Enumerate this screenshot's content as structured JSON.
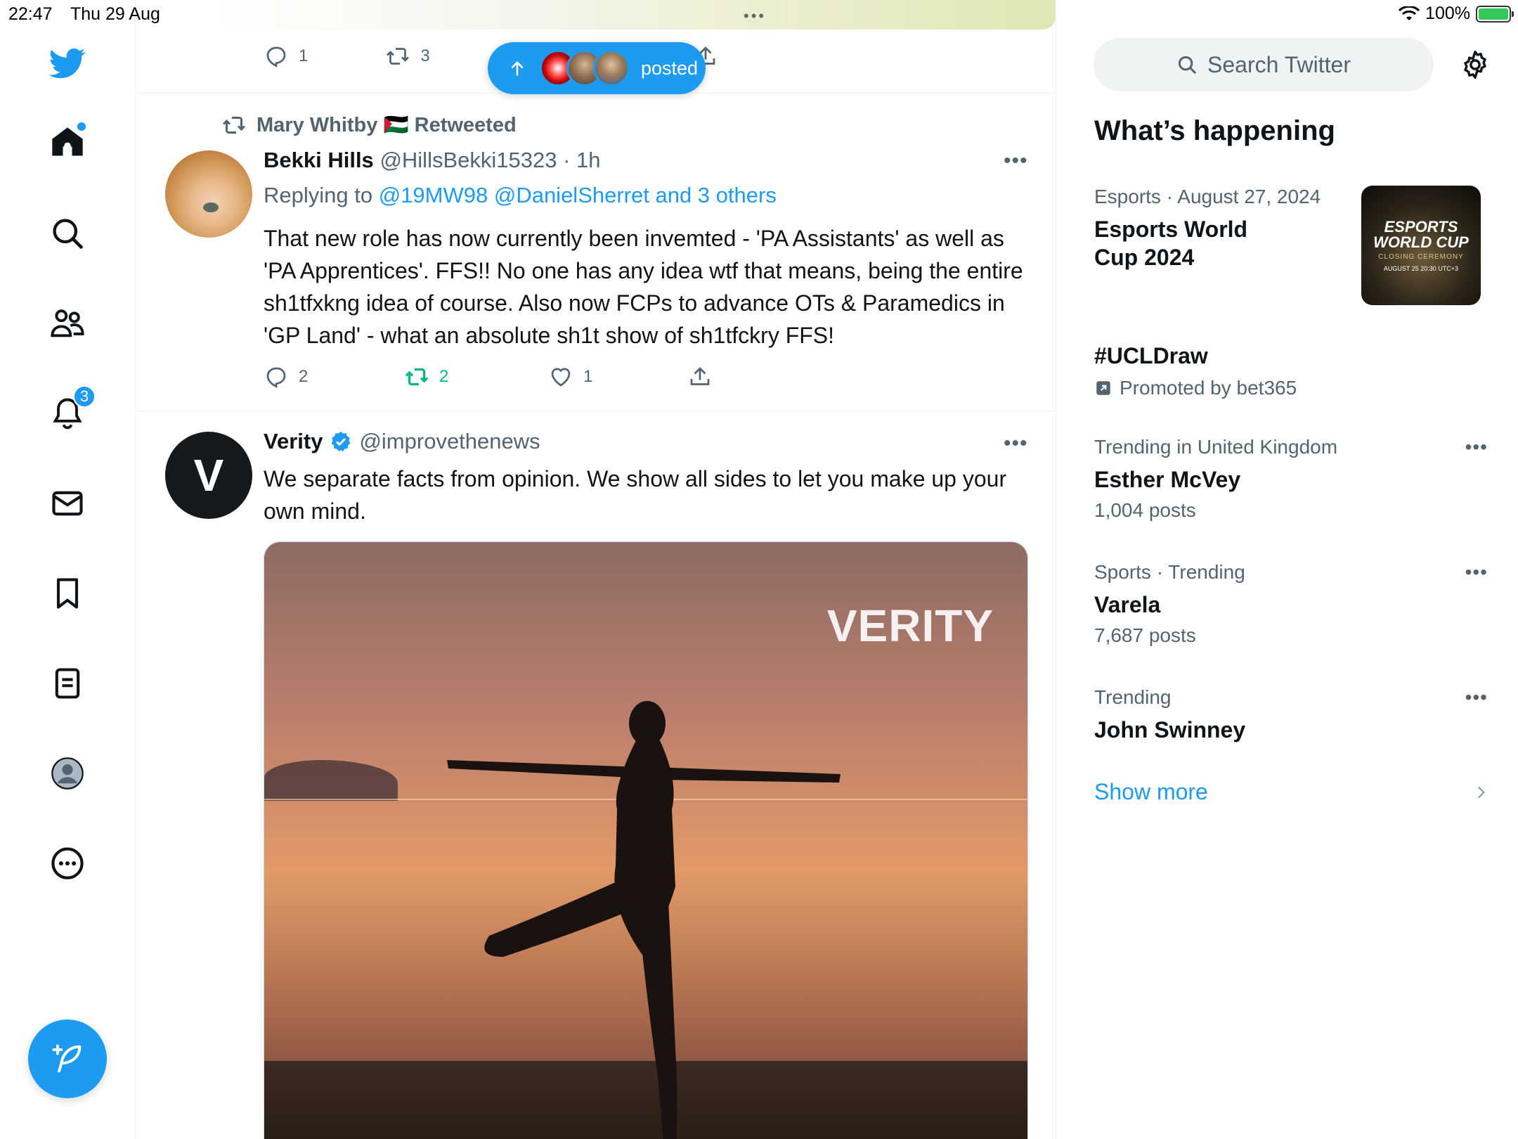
{
  "status_bar": {
    "time": "22:47",
    "date": "Thu 29 Aug",
    "battery_percent": "100%",
    "battery_level": 1.0
  },
  "nav": {
    "items": [
      {
        "name": "home",
        "icon": "home-icon",
        "has_dot": true
      },
      {
        "name": "explore",
        "icon": "search-icon"
      },
      {
        "name": "communities",
        "icon": "people-icon"
      },
      {
        "name": "notifications",
        "icon": "bell-icon",
        "badge": "3"
      },
      {
        "name": "messages",
        "icon": "envelope-icon"
      },
      {
        "name": "bookmarks",
        "icon": "bookmark-icon"
      },
      {
        "name": "lists",
        "icon": "list-icon"
      },
      {
        "name": "profile",
        "icon": "avatar-icon"
      },
      {
        "name": "more",
        "icon": "more-circle-icon"
      }
    ],
    "compose_icon": "compose-feather-icon",
    "accent_color": "#1d9bf0"
  },
  "timeline": {
    "top_tweet_actions": {
      "replies": "1",
      "retweets": "3"
    },
    "new_posts_pill": {
      "label": "posted"
    },
    "tweets": [
      {
        "social_context": "Mary Whitby 🇵🇸 Retweeted",
        "name": "Bekki Hills",
        "handle": "@HillsBekki15323",
        "time": "· 1h",
        "replying_prefix": "Replying to",
        "replying_to": "@19MW98 @DanielSherret and 3 others",
        "text": "That new role has now currently been invemted - 'PA Assistants' as well as 'PA  Apprentices'. FFS!! No one has any idea wtf that means, being the entire sh1tfxkng idea of course. Also now FCPs to advance OTs & Paramedics in 'GP Land' - what an absolute sh1t show of sh1tfckry FFS!",
        "replies": "2",
        "retweets": "2",
        "likes": "1",
        "retweeted_by_me": true
      },
      {
        "name": "Verity",
        "verified": true,
        "handle": "@improvethenews",
        "text": "We separate facts from opinion. We show all sides to let you make up your own mind.",
        "avatar_letter": "V",
        "media_watermark": "VERITY"
      }
    ]
  },
  "sidebar": {
    "search_placeholder": "Search Twitter",
    "section_title": "What’s happening",
    "trends": [
      {
        "context": "Esports · August 27, 2024",
        "title": "Esports World Cup 2024",
        "thumb_line1": "ESPORTS WORLD CUP",
        "thumb_line2": "CLOSING CEREMONY",
        "thumb_line3": "AUGUST 25 20:30 UTC+3"
      },
      {
        "title": "#UCLDraw",
        "promoted": "Promoted by bet365"
      },
      {
        "context": "Trending in United Kingdom",
        "title": "Esther McVey",
        "count": "1,004 posts"
      },
      {
        "context": "Sports · Trending",
        "title": "Varela",
        "count": "7,687 posts"
      },
      {
        "context": "Trending",
        "title": "John Swinney"
      }
    ],
    "show_more": "Show more"
  }
}
